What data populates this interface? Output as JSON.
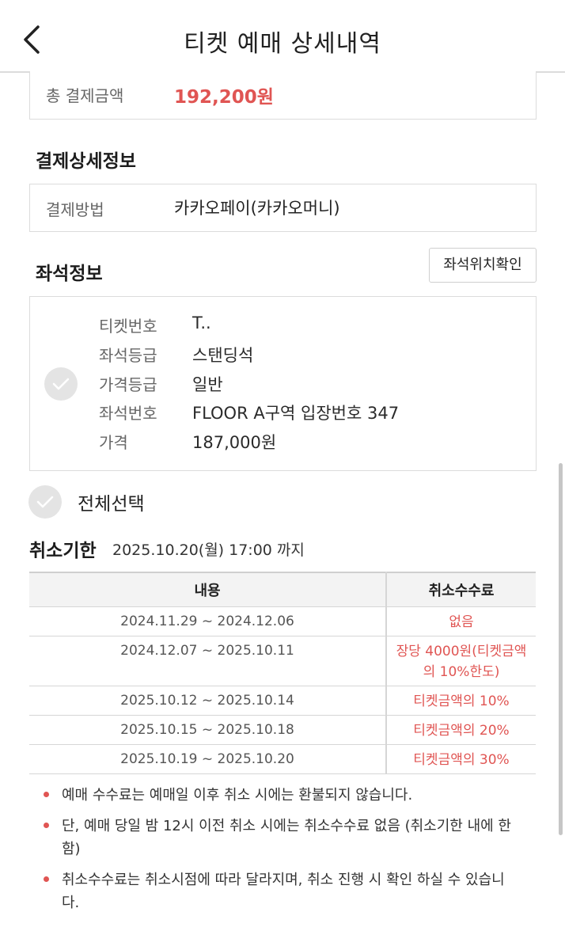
{
  "header": {
    "title": "티켓 예매 상세내역",
    "back_icon": "chevron-left-icon"
  },
  "total": {
    "label": "총 결제금액",
    "value": "192,200원"
  },
  "payment": {
    "section_title": "결제상세정보",
    "method_label": "결제방법",
    "method_value": "카카오페이(카카오머니)"
  },
  "seat": {
    "section_title": "좌석정보",
    "location_button": "좌석위치확인",
    "rows": [
      {
        "label": "티켓번호",
        "value": "T.."
      },
      {
        "label": "좌석등급",
        "value": "스탠딩석"
      },
      {
        "label": "가격등급",
        "value": "일반"
      },
      {
        "label": "좌석번호",
        "value": "FLOOR A구역 입장번호 347"
      },
      {
        "label": "가격",
        "value": "187,000원"
      }
    ]
  },
  "select_all": {
    "label": "전체선택"
  },
  "cancel": {
    "title": "취소기한",
    "deadline": "2025.10.20(월) 17:00 까지",
    "table": {
      "headers": [
        "내용",
        "취소수수료"
      ],
      "rows": [
        {
          "period": "2024.11.29 ~ 2024.12.06",
          "fee": "없음"
        },
        {
          "period": "2024.12.07 ~ 2025.10.11",
          "fee": "장당 4000원(티켓금액의 10%한도)"
        },
        {
          "period": "2025.10.12 ~ 2025.10.14",
          "fee": "티켓금액의 10%"
        },
        {
          "period": "2025.10.15 ~ 2025.10.18",
          "fee": "티켓금액의 20%"
        },
        {
          "period": "2025.10.19 ~ 2025.10.20",
          "fee": "티켓금액의 30%"
        }
      ]
    },
    "notes": [
      "예매 수수료는 예매일 이후 취소 시에는 환불되지 않습니다.",
      "단, 예매 당일 밤 12시 이전 취소 시에는 취소수수료 없음 (취소기한 내에 한함)",
      "취소수수료는 취소시점에 따라 달라지며, 취소 진행 시 확인 하실 수 있습니다."
    ]
  },
  "colors": {
    "accent": "#e05553",
    "border": "#dcdcdc",
    "check_bg": "#e4e4e4"
  }
}
